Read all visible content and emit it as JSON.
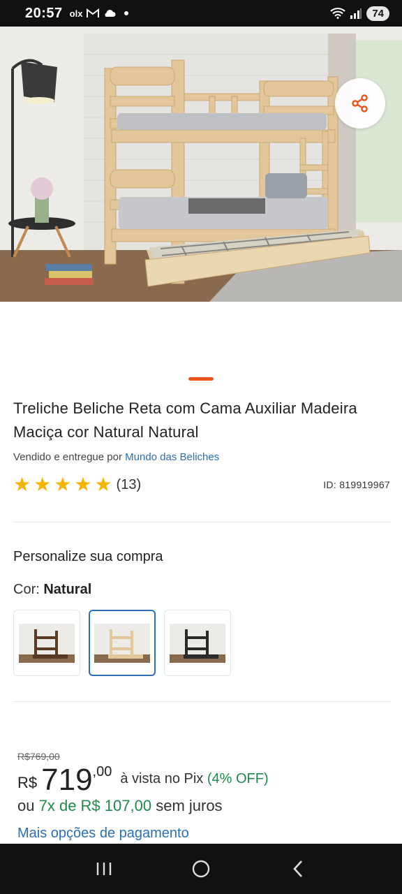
{
  "status_bar": {
    "time": "20:57",
    "notif_text": "olx",
    "battery": "74"
  },
  "product": {
    "title": "Treliche Beliche Reta com Cama Auxiliar Madeira Maciça cor Natural Natural",
    "seller_prefix": "Vendido e entregue por",
    "seller_name": "Mundo das Beliches",
    "rating_stars": 5,
    "review_count": "(13)",
    "id_text": "ID: 819919967"
  },
  "personalize": {
    "section_title": "Personalize sua compra",
    "color_label": "Cor:",
    "color_value": "Natural",
    "swatches": [
      {
        "name": "swatch-dark",
        "selected": false
      },
      {
        "name": "swatch-natural",
        "selected": true
      },
      {
        "name": "swatch-black",
        "selected": false
      }
    ]
  },
  "pricing": {
    "old_price": "R$769,00",
    "currency": "R$",
    "price_int": "719",
    "price_cents": ",00",
    "pix_text": "à vista no Pix",
    "pix_discount": "(4% OFF)",
    "installments_prefix": "ou",
    "installments_value": "7x de R$ 107,00",
    "installments_suffix": "sem juros",
    "more_payment_link": "Mais opções de pagamento"
  },
  "colors": {
    "accent_orange": "#e8561c",
    "link_blue": "#2a6fb8",
    "discount_green": "#1f8a4c",
    "star_yellow": "#f6b400"
  },
  "icons": {
    "share": "share-icon",
    "star": "star-icon"
  }
}
